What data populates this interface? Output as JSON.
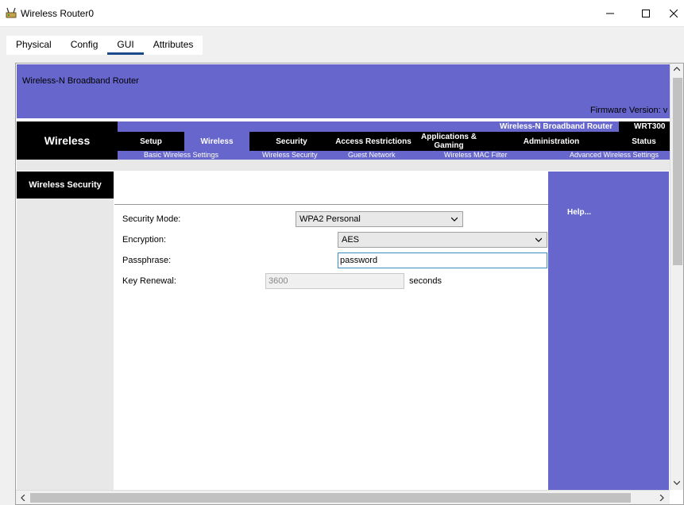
{
  "window": {
    "title": "Wireless Router0",
    "minimize": "—",
    "maximize": "☐",
    "close": "✕"
  },
  "tabs": [
    {
      "label": "Physical"
    },
    {
      "label": "Config"
    },
    {
      "label": "GUI"
    },
    {
      "label": "Attributes"
    }
  ],
  "router": {
    "model_title": "Wireless-N Broadband Router",
    "firmware": "Firmware Version: v",
    "section_name": "Wireless",
    "product_name": "Wireless-N Broadband Router",
    "model_number": "WRT300",
    "nav": [
      {
        "label": "Setup"
      },
      {
        "label": "Wireless"
      },
      {
        "label": "Security"
      },
      {
        "label": "Access Restrictions"
      },
      {
        "label": "Applications & Gaming"
      },
      {
        "label": "Administration"
      },
      {
        "label": "Status"
      }
    ],
    "subnav": [
      {
        "label": "Basic Wireless Settings"
      },
      {
        "label": "Wireless Security"
      },
      {
        "label": "Guest Network"
      },
      {
        "label": "Wireless MAC Filter"
      },
      {
        "label": "Advanced Wireless Settings"
      }
    ],
    "page_label": "Wireless Security",
    "help": "Help...",
    "form": {
      "security_mode_label": "Security Mode:",
      "security_mode_value": "WPA2 Personal",
      "encryption_label": "Encryption:",
      "encryption_value": "AES",
      "passphrase_label": "Passphrase:",
      "passphrase_value": "password",
      "key_renewal_label": "Key Renewal:",
      "key_renewal_value": "3600",
      "key_renewal_unit": "seconds"
    }
  },
  "colors": {
    "linksys_purple": "#6666cc",
    "tab_underline": "#1c4b8c"
  }
}
